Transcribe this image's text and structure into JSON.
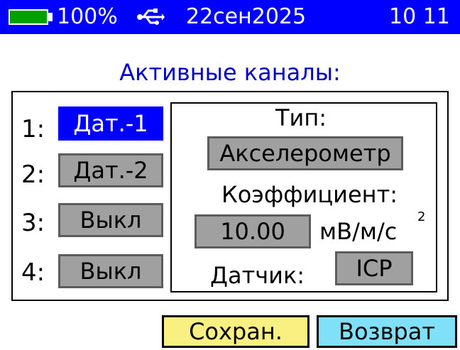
{
  "status": {
    "battery_percent": "100%",
    "battery_level": 1.0,
    "date": "22сен2025",
    "time": "10 11",
    "usb_icon": "usb-icon"
  },
  "title": "Активные каналы:",
  "channels": [
    {
      "number": "1:",
      "value": "Дат.-1",
      "selected": true
    },
    {
      "number": "2:",
      "value": "Дат.-2",
      "selected": false
    },
    {
      "number": "3:",
      "value": "Выкл",
      "selected": false
    },
    {
      "number": "4:",
      "value": "Выкл",
      "selected": false
    }
  ],
  "details": {
    "type_label": "Тип:",
    "type_value": "Акселерометр",
    "coef_label": "Коэффициент:",
    "coef_value": "10.00",
    "coef_unit": "мВ/м/с",
    "coef_unit_power": "2",
    "sensor_label": "Датчик:",
    "sensor_value": "ICP"
  },
  "buttons": {
    "save": "Сохран.",
    "back": "Возврат"
  },
  "colors": {
    "status_bg": "#0000ff",
    "title": "#0000c8",
    "selected": "#0000ff",
    "field_bg": "#a0a0a0",
    "save_bg": "#f8f080",
    "back_bg": "#80e0f8"
  }
}
